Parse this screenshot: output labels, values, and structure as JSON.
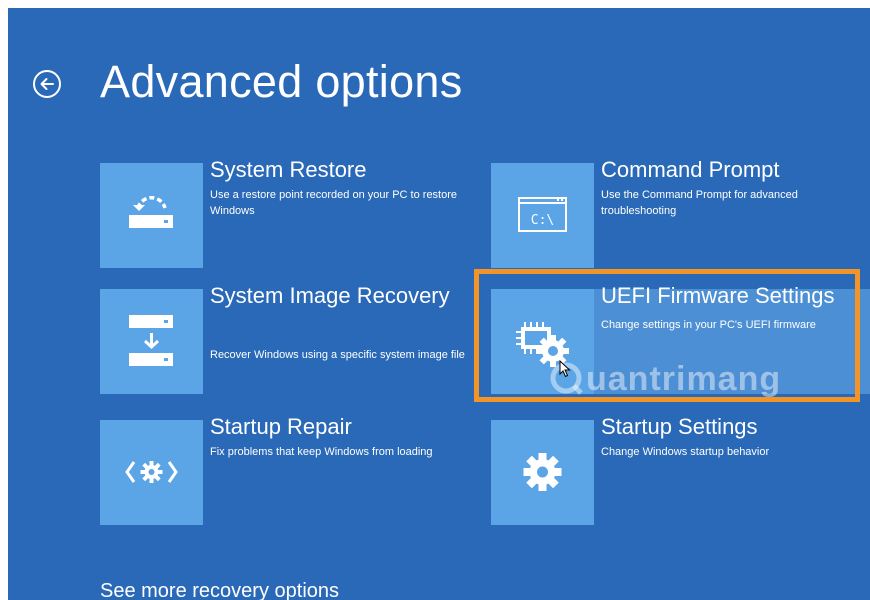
{
  "header": {
    "title": "Advanced options",
    "back_icon": "back-arrow-circle-icon"
  },
  "tiles": [
    {
      "title": "System Restore",
      "description": "Use a restore point recorded on your PC to restore Windows",
      "icon": "system-restore-icon"
    },
    {
      "title": "Command Prompt",
      "description": "Use the Command Prompt for advanced troubleshooting",
      "icon": "command-prompt-icon",
      "icon_text": "C:\\"
    },
    {
      "title": "System Image Recovery",
      "description": "Recover Windows using a specific system image file",
      "icon": "system-image-recovery-icon"
    },
    {
      "title": "UEFI Firmware Settings",
      "description": "Change settings in your PC's UEFI firmware",
      "icon": "uefi-chip-gear-icon",
      "highlighted": true
    },
    {
      "title": "Startup Repair",
      "description": "Fix problems that keep Windows from loading",
      "icon": "startup-repair-icon"
    },
    {
      "title": "Startup Settings",
      "description": "Change Windows startup behavior",
      "icon": "gear-icon"
    }
  ],
  "footer": {
    "more_link": "See more recovery options"
  },
  "watermark": {
    "text": "uantrimang"
  },
  "colors": {
    "background": "#2969b7",
    "tile_icon": "#5ba4e6",
    "highlight_border": "#f39427",
    "text": "#ffffff"
  }
}
